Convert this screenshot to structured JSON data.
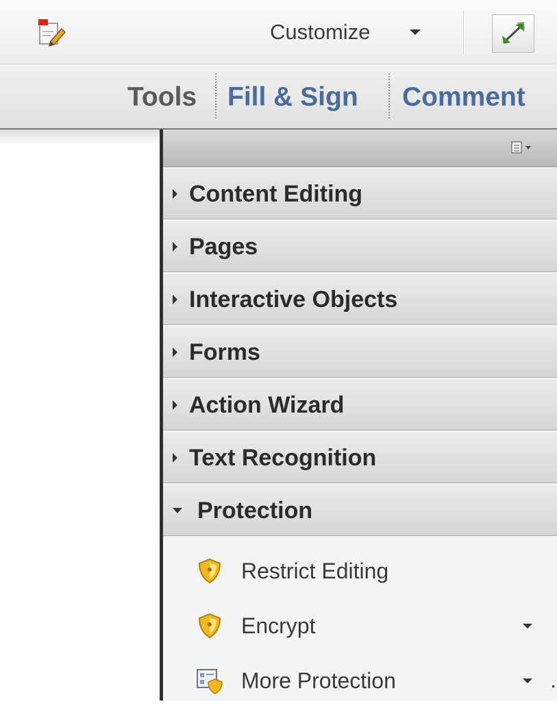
{
  "toolbar": {
    "edit_icon": "edit-pdf-icon",
    "customize_label": "Customize",
    "customize_icon": "chevron-down-icon",
    "expand_icon": "expand-arrows-icon"
  },
  "tabs": [
    {
      "label": "Tools"
    },
    {
      "label": "Fill & Sign"
    },
    {
      "label": "Comment"
    }
  ],
  "panel": {
    "options_icon": "panel-options-icon",
    "sections": [
      {
        "label": "Content Editing",
        "expanded": false
      },
      {
        "label": "Pages",
        "expanded": false
      },
      {
        "label": "Interactive Objects",
        "expanded": false
      },
      {
        "label": "Forms",
        "expanded": false
      },
      {
        "label": "Action Wizard",
        "expanded": false
      },
      {
        "label": "Text Recognition",
        "expanded": false
      },
      {
        "label": "Protection",
        "expanded": true
      }
    ],
    "protection_tools": [
      {
        "label": "Restrict Editing",
        "icon": "shield-icon",
        "has_menu": false
      },
      {
        "label": "Encrypt",
        "icon": "shield-icon",
        "has_menu": true
      },
      {
        "label": "More Protection",
        "icon": "certificate-shield-icon",
        "has_menu": true
      }
    ]
  },
  "colors": {
    "tab_active_text": "#4a6c9a",
    "tab_text": "#5a5a5a",
    "shield_gold": "#f2b81e"
  }
}
